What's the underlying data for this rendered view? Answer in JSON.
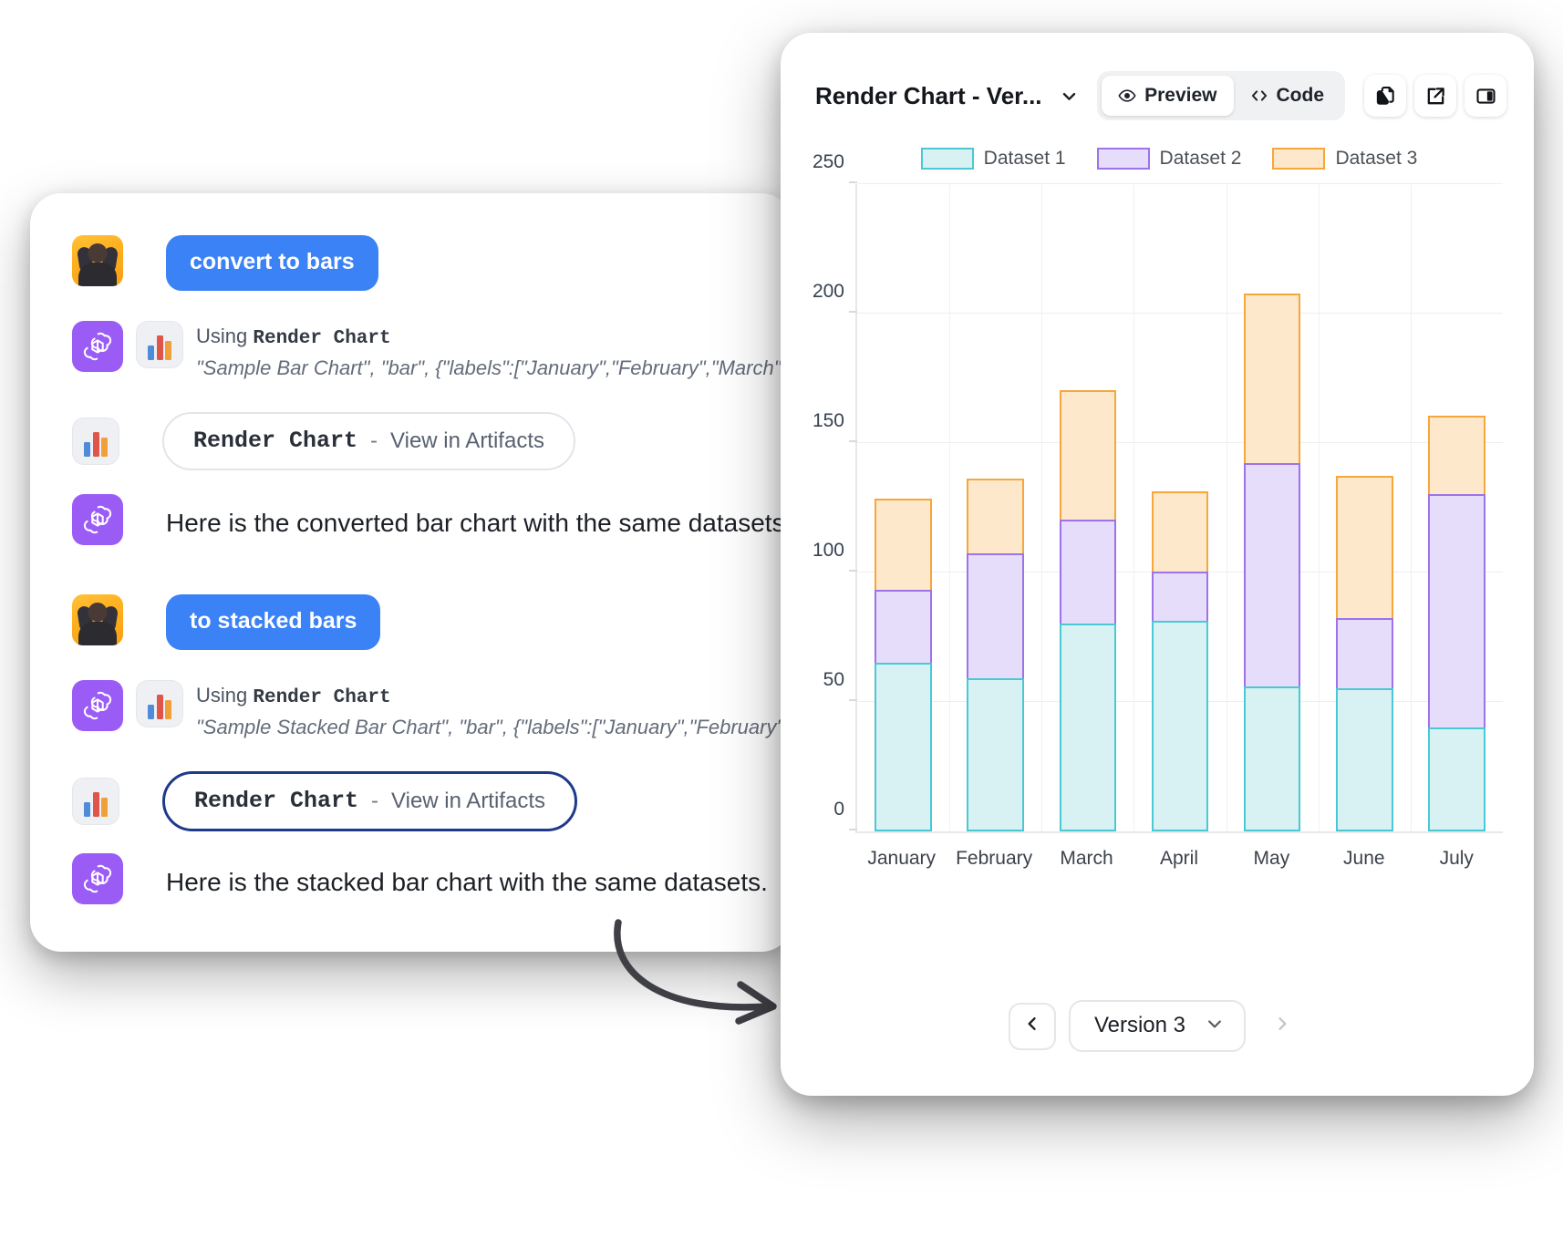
{
  "chat": {
    "messages": [
      {
        "role": "user",
        "text": "convert to bars",
        "avatar": "user-avatar"
      },
      {
        "role": "assistant-tool",
        "using_prefix": "Using",
        "tool_name": "Render Chart",
        "args": "\"Sample Bar Chart\", \"bar\", {\"labels\":[\"January\",\"February\",\"March\",\"April\",\"",
        "icon": "bar-chart-icon"
      },
      {
        "role": "artifact-pill",
        "name": "Render Chart",
        "dash": "-",
        "action": "View in Artifacts",
        "active": false,
        "icon": "bar-chart-icon"
      },
      {
        "role": "assistant",
        "text": "Here is the converted bar chart with the same datasets."
      },
      {
        "role": "user",
        "text": "to stacked bars",
        "avatar": "user-avatar"
      },
      {
        "role": "assistant-tool",
        "using_prefix": "Using",
        "tool_name": "Render Chart",
        "args": "\"Sample Stacked Bar Chart\", \"bar\", {\"labels\":[\"January\",\"February\",\"March",
        "icon": "bar-chart-icon"
      },
      {
        "role": "artifact-pill",
        "name": "Render Chart",
        "dash": "-",
        "action": "View in Artifacts",
        "active": true,
        "icon": "bar-chart-icon"
      },
      {
        "role": "assistant",
        "text": "Here is the stacked bar chart with the same datasets."
      }
    ]
  },
  "artifact": {
    "title": "Render Chart - Ver...",
    "title_chevron_icon": "chevron-down-icon",
    "toolbar": {
      "preview_label": "Preview",
      "preview_icon": "eye-icon",
      "code_label": "Code",
      "code_icon": "code-brackets-icon",
      "selected": "Preview",
      "copy_icon": "copy-icon",
      "open_external_icon": "external-link-icon",
      "panel_toggle_icon": "side-panel-icon"
    },
    "version_bar": {
      "prev_icon": "chevron-left-icon",
      "next_icon": "chevron-right-icon",
      "version_label": "Version 3",
      "select_chevron_icon": "chevron-down-icon"
    }
  },
  "colors": {
    "user_bubble": "#3b82f6",
    "gpt_avatar": "#9b5cf6",
    "dataset1_fill": "#d8f2f3",
    "dataset1_stroke": "#4bc8d4",
    "dataset2_fill": "#e6ddfb",
    "dataset2_stroke": "#9e72e8",
    "dataset3_fill": "#fde8cb",
    "dataset3_stroke": "#f7a63c",
    "active_pill_border": "#1e3a8a"
  },
  "chart_data": {
    "type": "bar",
    "stacked": true,
    "title": "Sample Stacked Bar Chart",
    "xlabel": "",
    "ylabel": "",
    "ylim": [
      0,
      250
    ],
    "yticks": [
      0,
      50,
      100,
      150,
      200,
      250
    ],
    "grid": true,
    "legend_position": "top",
    "categories": [
      "January",
      "February",
      "March",
      "April",
      "May",
      "June",
      "July"
    ],
    "series": [
      {
        "name": "Dataset 1",
        "values": [
          65,
          59,
          80,
          81,
          56,
          55,
          40
        ]
      },
      {
        "name": "Dataset 2",
        "values": [
          28,
          48,
          40,
          19,
          86,
          27,
          90
        ]
      },
      {
        "name": "Dataset 3",
        "values": [
          35,
          29,
          50,
          31,
          65,
          55,
          30
        ]
      }
    ]
  }
}
